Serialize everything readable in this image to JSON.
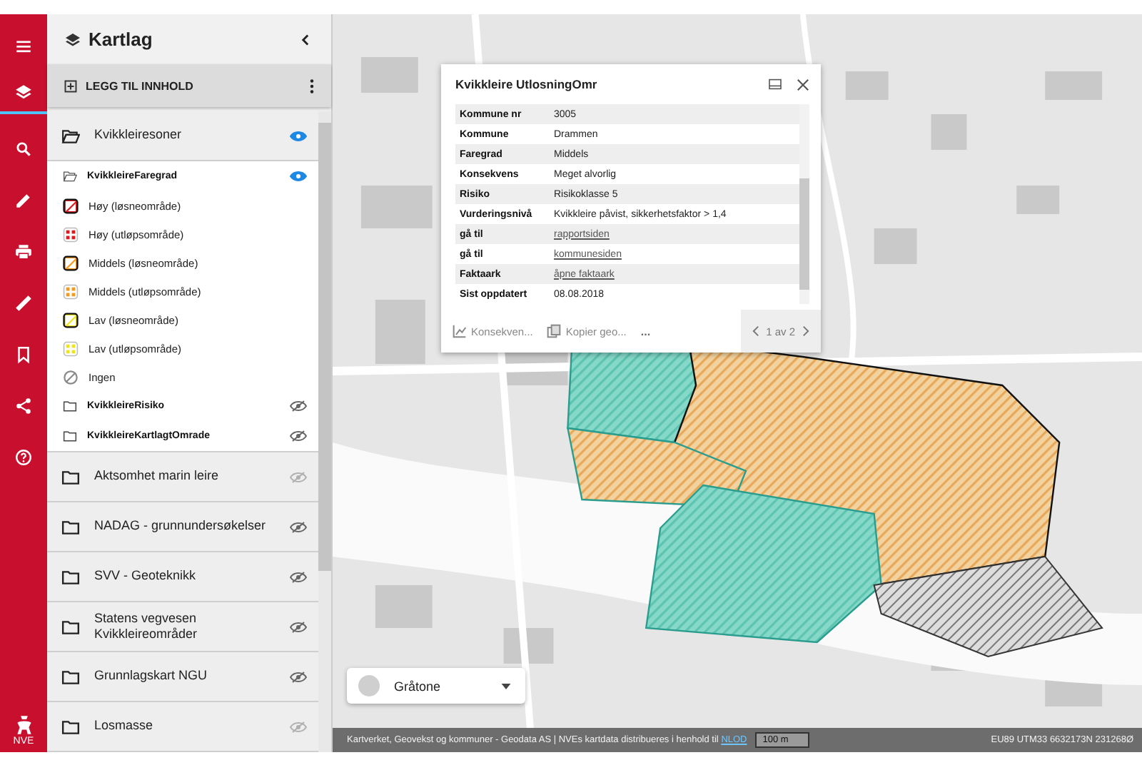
{
  "rail": {
    "items": [
      {
        "selected": false
      },
      {
        "selected": true
      },
      {
        "selected": false
      },
      {
        "selected": false
      },
      {
        "selected": false
      },
      {
        "selected": false
      },
      {
        "selected": false
      },
      {
        "selected": false
      },
      {
        "selected": false
      }
    ],
    "logo": "NVE"
  },
  "panel": {
    "title": "Kartlag",
    "add_button": "LEGG TIL INNHOLD",
    "groups": [
      {
        "name": "Kvikkleiresoner",
        "expanded": true,
        "visible": true,
        "dimmed": false,
        "children": [
          {
            "name": "KvikkleireFaregrad",
            "expanded": true,
            "visible": true,
            "legend": [
              {
                "label": "Høy (løsneområde)",
                "kind": "hatch",
                "color": "#e0191f"
              },
              {
                "label": "Høy (utløpsområde)",
                "kind": "grid",
                "color": "#e0191f"
              },
              {
                "label": "Middels (løsneområde)",
                "kind": "hatch",
                "color": "#f39a1a"
              },
              {
                "label": "Middels (utløpsområde)",
                "kind": "grid",
                "color": "#f39a1a"
              },
              {
                "label": "Lav (løsneområde)",
                "kind": "hatch",
                "color": "#efe41a"
              },
              {
                "label": "Lav (utløpsområde)",
                "kind": "grid",
                "color": "#efe41a"
              },
              {
                "label": "Ingen",
                "kind": "none",
                "color": "#8a8a8a"
              }
            ]
          },
          {
            "name": "KvikkleireRisiko",
            "expanded": false,
            "visible": false
          },
          {
            "name": "KvikkleireKartlagtOmrade",
            "expanded": false,
            "visible": false
          }
        ]
      },
      {
        "name": "Aktsomhet marin leire",
        "expanded": false,
        "visible": false,
        "dimmed": true
      },
      {
        "name": "NADAG - grunnundersøkelser",
        "expanded": false,
        "visible": false,
        "dimmed": false
      },
      {
        "name": "SVV - Geoteknikk",
        "expanded": false,
        "visible": false,
        "dimmed": false
      },
      {
        "name": "Statens vegvesen Kvikkleireområder",
        "expanded": false,
        "visible": false,
        "dimmed": false
      },
      {
        "name": "Grunnlagskart NGU",
        "expanded": false,
        "visible": false,
        "dimmed": false
      },
      {
        "name": "Losmasse",
        "expanded": false,
        "visible": false,
        "dimmed": true
      }
    ]
  },
  "popup": {
    "title": "Kvikkleire UtlosningOmr",
    "rows": [
      {
        "label": "Kommune nr",
        "value": "3005",
        "kind": "text"
      },
      {
        "label": "Kommune",
        "value": "Drammen",
        "kind": "text"
      },
      {
        "label": "Faregrad",
        "value": "Middels",
        "kind": "text"
      },
      {
        "label": "Konsekvens",
        "value": "Meget alvorlig",
        "kind": "text"
      },
      {
        "label": "Risiko",
        "value": "Risikoklasse 5",
        "kind": "text"
      },
      {
        "label": "Vurderingsnivå",
        "value": "Kvikkleire påvist, sikkerhetsfaktor > 1,4",
        "kind": "text"
      },
      {
        "label": "gå til",
        "value": "rapportsiden",
        "kind": "link"
      },
      {
        "label": "gå til",
        "value": "kommunesiden",
        "kind": "link"
      },
      {
        "label": "Faktaark",
        "value": "åpne faktaark",
        "kind": "link"
      },
      {
        "label": "Sist oppdatert",
        "value": "08.08.2018",
        "kind": "text"
      }
    ],
    "actions": [
      {
        "label": "Konsekven..."
      },
      {
        "label": "Kopier geo..."
      }
    ],
    "more": "...",
    "pager": "1 av 2"
  },
  "basemap": {
    "label": "Gråtone"
  },
  "status_bar": {
    "attribution": "Kartverket, Geovekst og kommuner - Geodata AS | NVEs kartdata distribueres i henhold til",
    "attribution_link": "NLOD",
    "scale": "100 m",
    "coordinates": "EU89 UTM33 6632173N 231268Ø"
  }
}
